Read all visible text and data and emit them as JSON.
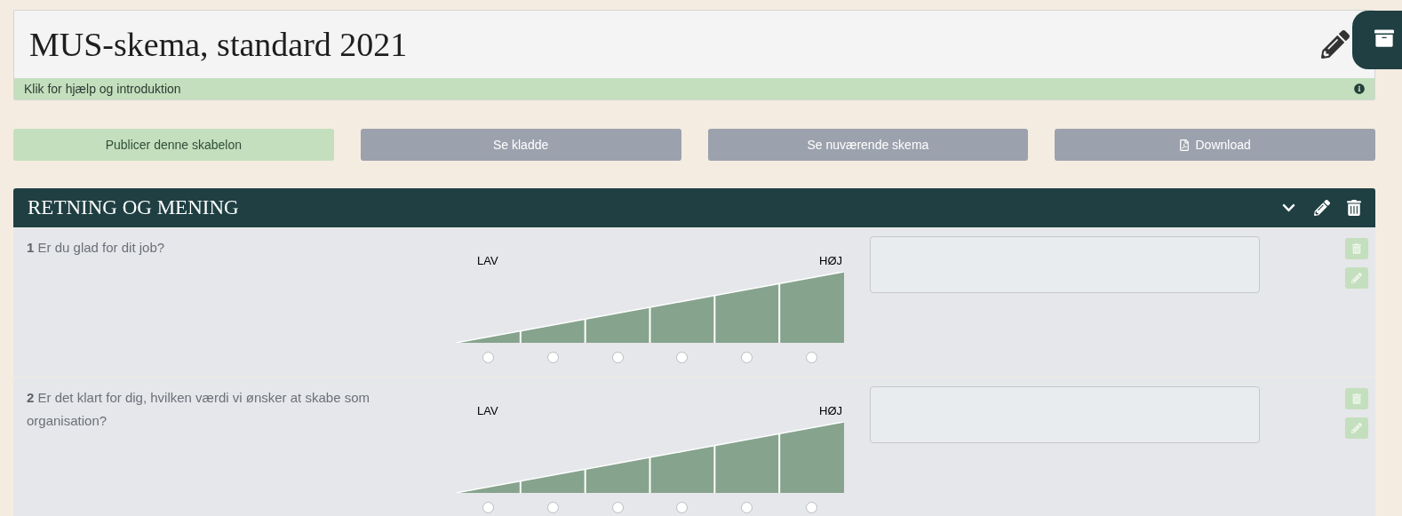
{
  "header": {
    "title": "MUS-skema, standard 2021",
    "help_text": "Klik for hjælp og introduktion"
  },
  "actions": [
    {
      "label": "Publicer denne skabelon",
      "kind": "primary"
    },
    {
      "label": "Se kladde",
      "kind": "secondary"
    },
    {
      "label": "Se nuværende skema",
      "kind": "secondary"
    },
    {
      "label": "Download",
      "kind": "download"
    }
  ],
  "section": {
    "title": "RETNING OG MENING",
    "questions": [
      {
        "number": "1",
        "text": "Er du glad for dit job?",
        "low_label": "LAV",
        "high_label": "HØJ",
        "options": [
          {
            "selected": false
          },
          {
            "selected": false
          },
          {
            "selected": false
          },
          {
            "selected": false
          },
          {
            "selected": false
          },
          {
            "selected": false
          }
        ]
      },
      {
        "number": "2",
        "text": "Er det klart for dig, hvilken værdi vi ønsker at skabe som organisation?",
        "low_label": "LAV",
        "high_label": "HØJ",
        "options": [
          {
            "selected": false
          },
          {
            "selected": false
          },
          {
            "selected": false
          },
          {
            "selected": false
          },
          {
            "selected": false
          },
          {
            "selected": false
          }
        ]
      }
    ]
  }
}
